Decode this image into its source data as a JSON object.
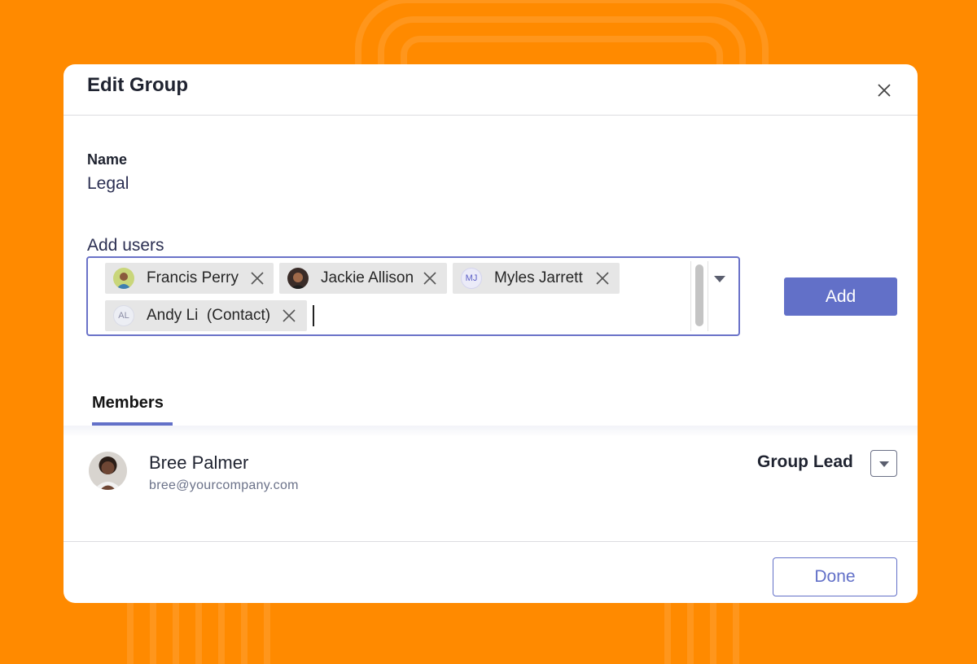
{
  "colors": {
    "background": "#FF8A00",
    "accent": "#6270C8",
    "dialog": "#FFFFFF",
    "chip": "#E6E6E6"
  },
  "dialog": {
    "title": "Edit Group",
    "close_icon": "close-icon"
  },
  "name_field": {
    "label": "Name",
    "value": "Legal"
  },
  "add_users": {
    "label": "Add users",
    "chips": [
      {
        "name": "Francis Perry",
        "avatar": "photo",
        "remove_icon": "close-icon"
      },
      {
        "name": "Jackie Allison",
        "avatar": "photo",
        "remove_icon": "close-icon"
      },
      {
        "name": "Myles Jarrett",
        "initials": "MJ",
        "remove_icon": "close-icon"
      },
      {
        "name": "Andy Li  (Contact)",
        "initials": "AL",
        "remove_icon": "close-icon"
      }
    ],
    "dropdown_icon": "caret-down-icon",
    "add_label": "Add"
  },
  "members": {
    "tab_label": "Members",
    "list": [
      {
        "name": "Bree Palmer",
        "email": "bree@yourcompany.com",
        "role": "Group Lead",
        "role_dropdown_icon": "caret-down-icon"
      }
    ]
  },
  "footer": {
    "done_label": "Done"
  }
}
